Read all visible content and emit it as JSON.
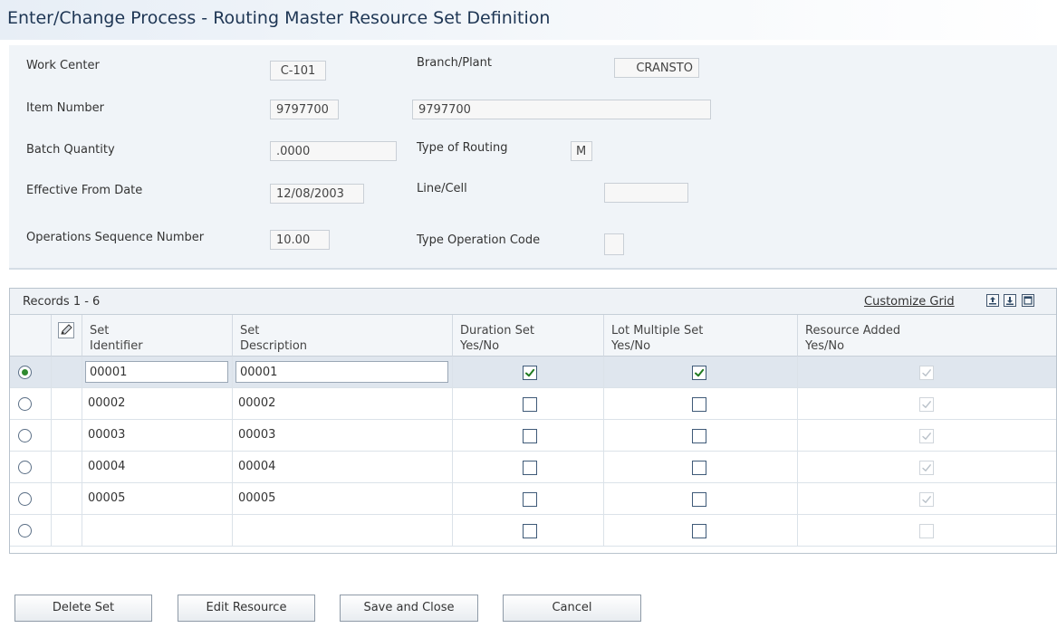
{
  "page": {
    "title": "Enter/Change Process - Routing Master Resource Set Definition"
  },
  "header": {
    "work_center_label": "Work Center",
    "work_center_value": "C-101",
    "branch_plant_label": "Branch/Plant",
    "branch_plant_value": "CRANSTO",
    "item_number_label": "Item Number",
    "item_number_value": "9797700",
    "item_description_value": "9797700",
    "batch_quantity_label": "Batch Quantity",
    "batch_quantity_value": ".0000",
    "type_of_routing_label": "Type of Routing",
    "type_of_routing_value": "M",
    "effective_from_label": "Effective From Date",
    "effective_from_value": "12/08/2003",
    "line_cell_label": "Line/Cell",
    "line_cell_value": "",
    "ops_seq_label": "Operations Sequence Number",
    "ops_seq_value": "10.00",
    "type_op_code_label": "Type Operation Code",
    "type_op_code_value": ""
  },
  "grid": {
    "records_label": "Records 1 - 6",
    "customize_label": "Customize Grid",
    "columns": {
      "set_identifier_1": "Set",
      "set_identifier_2": "Identifier",
      "set_description_1": "Set",
      "set_description_2": "Description",
      "duration_set_1": "Duration Set",
      "duration_set_2": "Yes/No",
      "lot_multiple_1": "Lot Multiple Set",
      "lot_multiple_2": "Yes/No",
      "resource_added_1": "Resource Added",
      "resource_added_2": "Yes/No"
    },
    "rows": [
      {
        "set_id": "00001",
        "description": "00001",
        "duration": true,
        "lot_multiple": true,
        "resource_added": true,
        "selected": true
      },
      {
        "set_id": "00002",
        "description": "00002",
        "duration": false,
        "lot_multiple": false,
        "resource_added": true,
        "selected": false
      },
      {
        "set_id": "00003",
        "description": "00003",
        "duration": false,
        "lot_multiple": false,
        "resource_added": true,
        "selected": false
      },
      {
        "set_id": "00004",
        "description": "00004",
        "duration": false,
        "lot_multiple": false,
        "resource_added": true,
        "selected": false
      },
      {
        "set_id": "00005",
        "description": "00005",
        "duration": false,
        "lot_multiple": false,
        "resource_added": true,
        "selected": false
      },
      {
        "set_id": "",
        "description": "",
        "duration": false,
        "lot_multiple": false,
        "resource_added": false,
        "selected": false
      }
    ]
  },
  "buttons": {
    "delete_set": "Delete Set",
    "edit_resource": "Edit Resource",
    "save_and_close": "Save and Close",
    "cancel": "Cancel"
  },
  "icons": {
    "grid_edit": "pencil-edit-icon",
    "export": "export-icon",
    "import": "import-icon",
    "maximize": "maximize-icon"
  },
  "colors": {
    "check_active": "#1f7a1f",
    "check_disabled": "#b9c1c9",
    "selected_row": "#dfe6ee"
  }
}
